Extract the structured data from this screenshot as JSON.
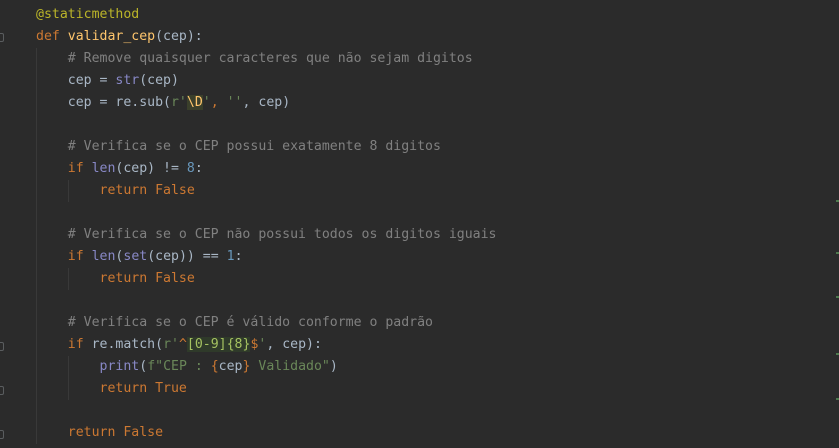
{
  "editor": {
    "colors": {
      "background": "#2b2b2b",
      "keyword": "#cc7832",
      "function": "#ffc66d",
      "comment": "#808080",
      "string": "#6a8759",
      "number": "#6897bb",
      "builtin": "#8888c6",
      "decorator": "#bbb529",
      "text": "#a9b7c6"
    },
    "lines": {
      "l1": {
        "decorator": "@staticmethod"
      },
      "l2": {
        "kw_def": "def ",
        "fn_name": "validar_cep",
        "params": "(cep):"
      },
      "l3": {
        "comment": "# Remove quaisquer caracteres que não sejam digitos"
      },
      "l4": {
        "lhs": "cep = ",
        "builtin": "str",
        "rest": "(cep)"
      },
      "l5": {
        "lhs": "cep = re.sub(",
        "str_prefix": "r'",
        "regex_esc": "\\D",
        "str_suffix": "'",
        "sep": ", ",
        "empty_str": "''",
        "rest": ", cep)"
      },
      "l6": {},
      "l7": {
        "comment": "# Verifica se o CEP possui exatamente 8 digitos"
      },
      "l8": {
        "kw_if": "if ",
        "builtin": "len",
        "mid": "(cep) != ",
        "num": "8",
        "end": ":"
      },
      "l9": {
        "kw_return": "return ",
        "kw_false": "False"
      },
      "l10": {},
      "l11": {
        "comment": "# Verifica se o CEP não possui todos os digitos iguais"
      },
      "l12": {
        "kw_if": "if ",
        "builtin_len": "len",
        "open": "(",
        "builtin_set": "set",
        "mid": "(cep)) == ",
        "num": "1",
        "end": ":"
      },
      "l13": {
        "kw_return": "return ",
        "kw_false": "False"
      },
      "l14": {},
      "l15": {
        "comment": "# Verifica se o CEP é válido conforme o padrão"
      },
      "l16": {
        "kw_if": "if ",
        "mid": "re.match(",
        "str_prefix": "r'",
        "anchor_start": "^",
        "char_class": "[0-9]",
        "quant": "{8}",
        "anchor_end": "$",
        "str_suffix": "'",
        "rest": ", cep):"
      },
      "l17": {
        "builtin_print": "print",
        "open": "(",
        "fstr_prefix": "f\"CEP : ",
        "brace_open": "{",
        "var": "cep",
        "brace_close": "}",
        "fstr_suffix": " Validado\"",
        "close": ")"
      },
      "l18": {
        "kw_return": "return ",
        "kw_true": "True"
      },
      "l19": {},
      "l20": {
        "kw_return": "return ",
        "kw_false": "False"
      }
    }
  }
}
